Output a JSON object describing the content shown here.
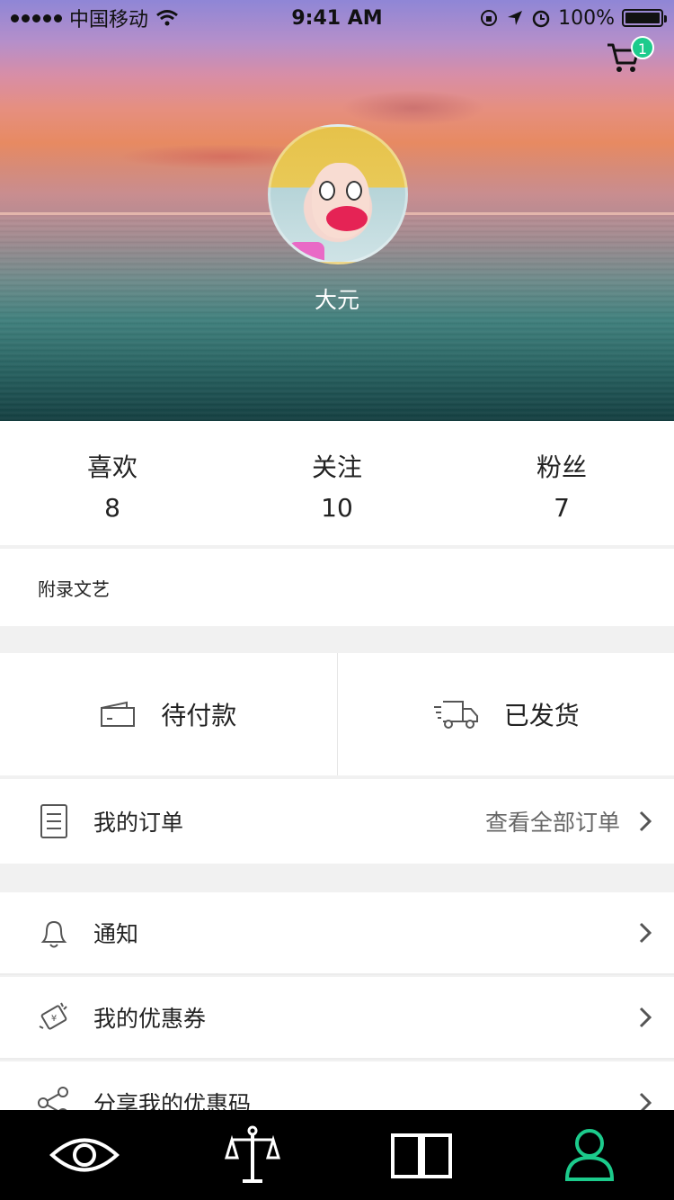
{
  "status_bar": {
    "carrier": "中国移动",
    "time": "9:41 AM",
    "battery": "100%"
  },
  "header": {
    "cart_badge": "1",
    "username": "大元"
  },
  "stats": [
    {
      "label": "喜欢",
      "value": "8"
    },
    {
      "label": "关注",
      "value": "10"
    },
    {
      "label": "粉丝",
      "value": "7"
    }
  ],
  "signature": "附录文艺",
  "orders": {
    "pending_payment": "待付款",
    "shipped": "已发货"
  },
  "menu": {
    "my_orders": "我的订单",
    "view_all_orders": "查看全部订单",
    "notifications": "通知",
    "my_coupons": "我的优惠券",
    "share_coupon_code": "分享我的优惠码"
  },
  "tabbar": {
    "icons": [
      "eye-icon",
      "scale-icon",
      "book-icon",
      "profile-icon"
    ],
    "active_color": "#1ccb8c"
  },
  "colors": {
    "accent": "#1ccb8c"
  }
}
